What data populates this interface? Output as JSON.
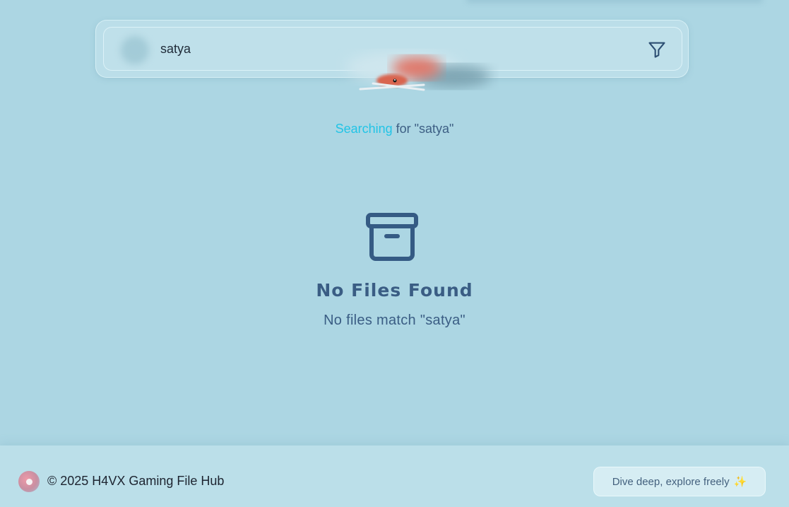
{
  "search": {
    "value": "satya",
    "placeholder": "",
    "filter_icon": "filter-icon"
  },
  "status": {
    "searching_word": "Searching",
    "searching_rest": " for \"satya\""
  },
  "empty_state": {
    "icon": "archive-box-icon",
    "title": "No Files Found",
    "subtitle": "No files match \"satya\""
  },
  "footer": {
    "copyright": "© 2025 H4VX Gaming File Hub",
    "tagline": "Dive deep, explore freely",
    "tagline_icon": "✨"
  },
  "colors": {
    "background": "#acd6e3",
    "accent": "#22c4e6",
    "text_primary": "#3a5d84",
    "footer_background": "#bbdfe9"
  }
}
